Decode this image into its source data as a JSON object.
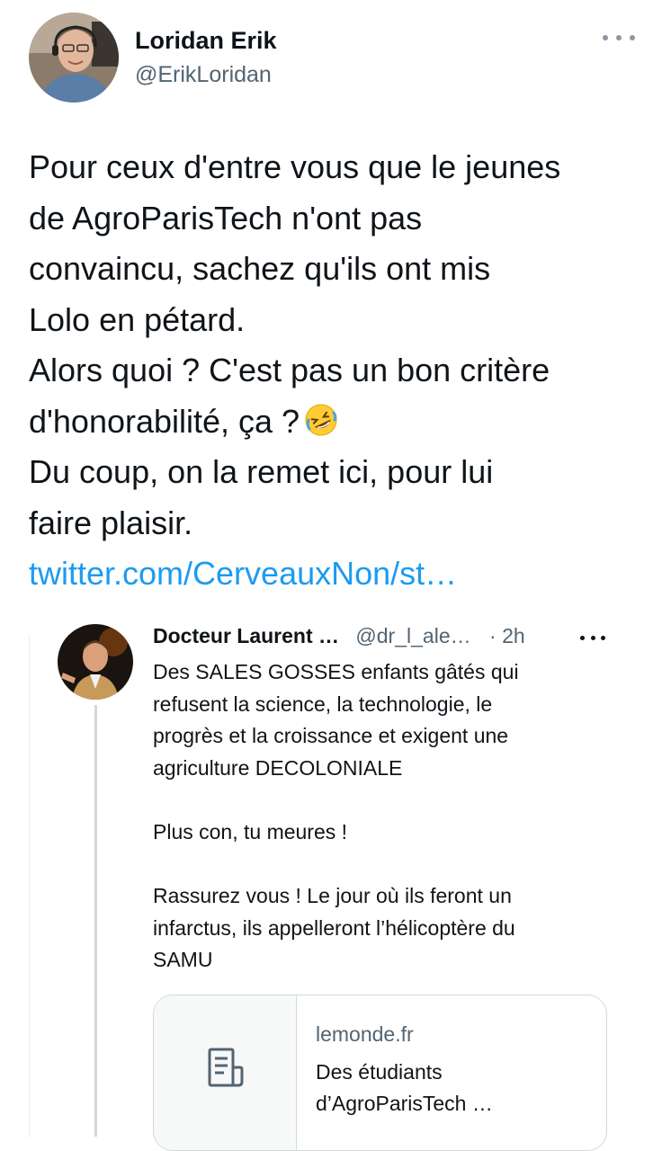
{
  "tweet": {
    "author_name": "Loridan Erik",
    "author_handle": "@ErikLoridan",
    "text_lines": [
      "Pour ceux d'entre vous que le jeunes",
      "de AgroParisTech n'ont pas",
      "convaincu, sachez qu'ils ont mis",
      "Lolo en pétard.",
      "Alors quoi ? C'est pas un bon critère",
      "d'honorabilité, ça ?",
      "Du coup, on la remet ici, pour lui",
      "faire plaisir."
    ],
    "link_text": "twitter.com/CerveauxNon/st…",
    "emoji": "rolling-on-floor-laughing-emoji"
  },
  "quoted_tweet": {
    "author_name": "Docteur Laurent …",
    "author_handle": "@dr_l_ale…",
    "separator": "·",
    "time": "2h",
    "paragraph1_lines": [
      "Des SALES GOSSES enfants gâtés qui",
      "refusent la science, la technologie, le",
      "progrès et la croissance et exigent une",
      "agriculture DECOLONIALE"
    ],
    "paragraph2_lines": [
      "Plus con, tu meures !"
    ],
    "paragraph3_lines": [
      "Rassurez vous ! Le jour où ils feront un",
      "infarctus, ils appelleront l’hélicoptère du",
      "SAMU"
    ]
  },
  "link_card": {
    "domain": "lemonde.fr",
    "title_lines": [
      "Des étudiants",
      "d’AgroParisTech …"
    ],
    "icon": "document-icon"
  },
  "colors": {
    "link": "#1d9bf0",
    "secondary_text": "#536471",
    "border": "#cfd9de"
  }
}
